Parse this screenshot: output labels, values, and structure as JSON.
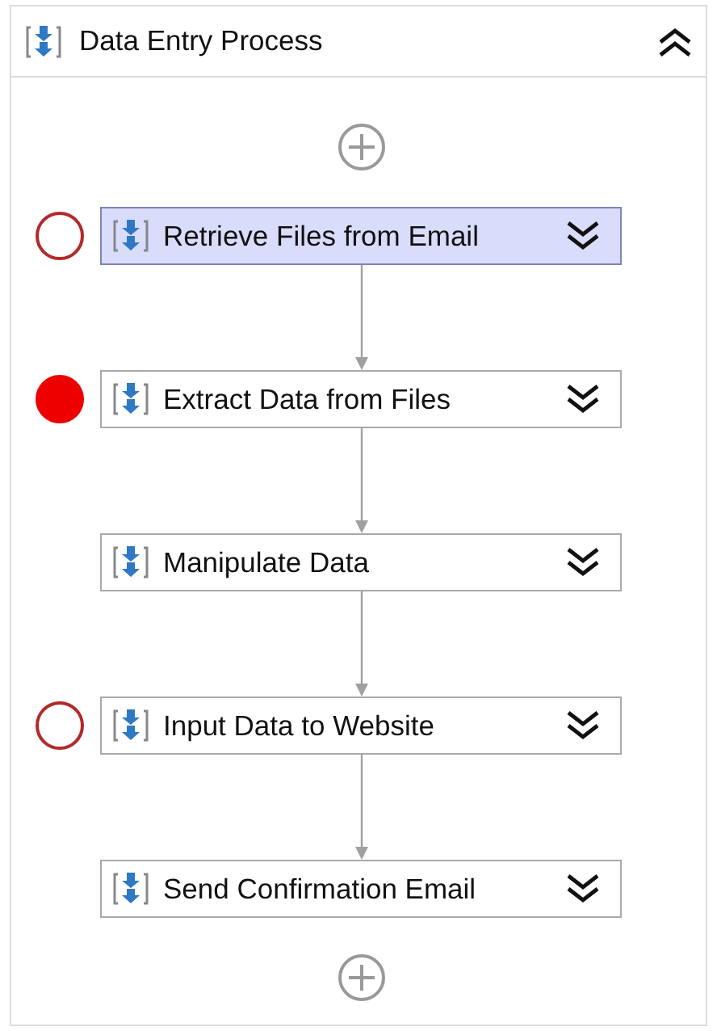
{
  "sequence": {
    "title": "Data Entry Process",
    "expanded": true,
    "steps": [
      {
        "label": "Retrieve Files from Email",
        "selected": true,
        "breakpoint": true,
        "breakpoint_enabled": false
      },
      {
        "label": "Extract Data from Files",
        "selected": false,
        "breakpoint": true,
        "breakpoint_enabled": true
      },
      {
        "label": "Manipulate Data",
        "selected": false,
        "breakpoint": false
      },
      {
        "label": "Input Data to Website",
        "selected": false,
        "breakpoint": true,
        "breakpoint_enabled": false
      },
      {
        "label": "Send Confirmation Email",
        "selected": false,
        "breakpoint": false
      }
    ]
  }
}
